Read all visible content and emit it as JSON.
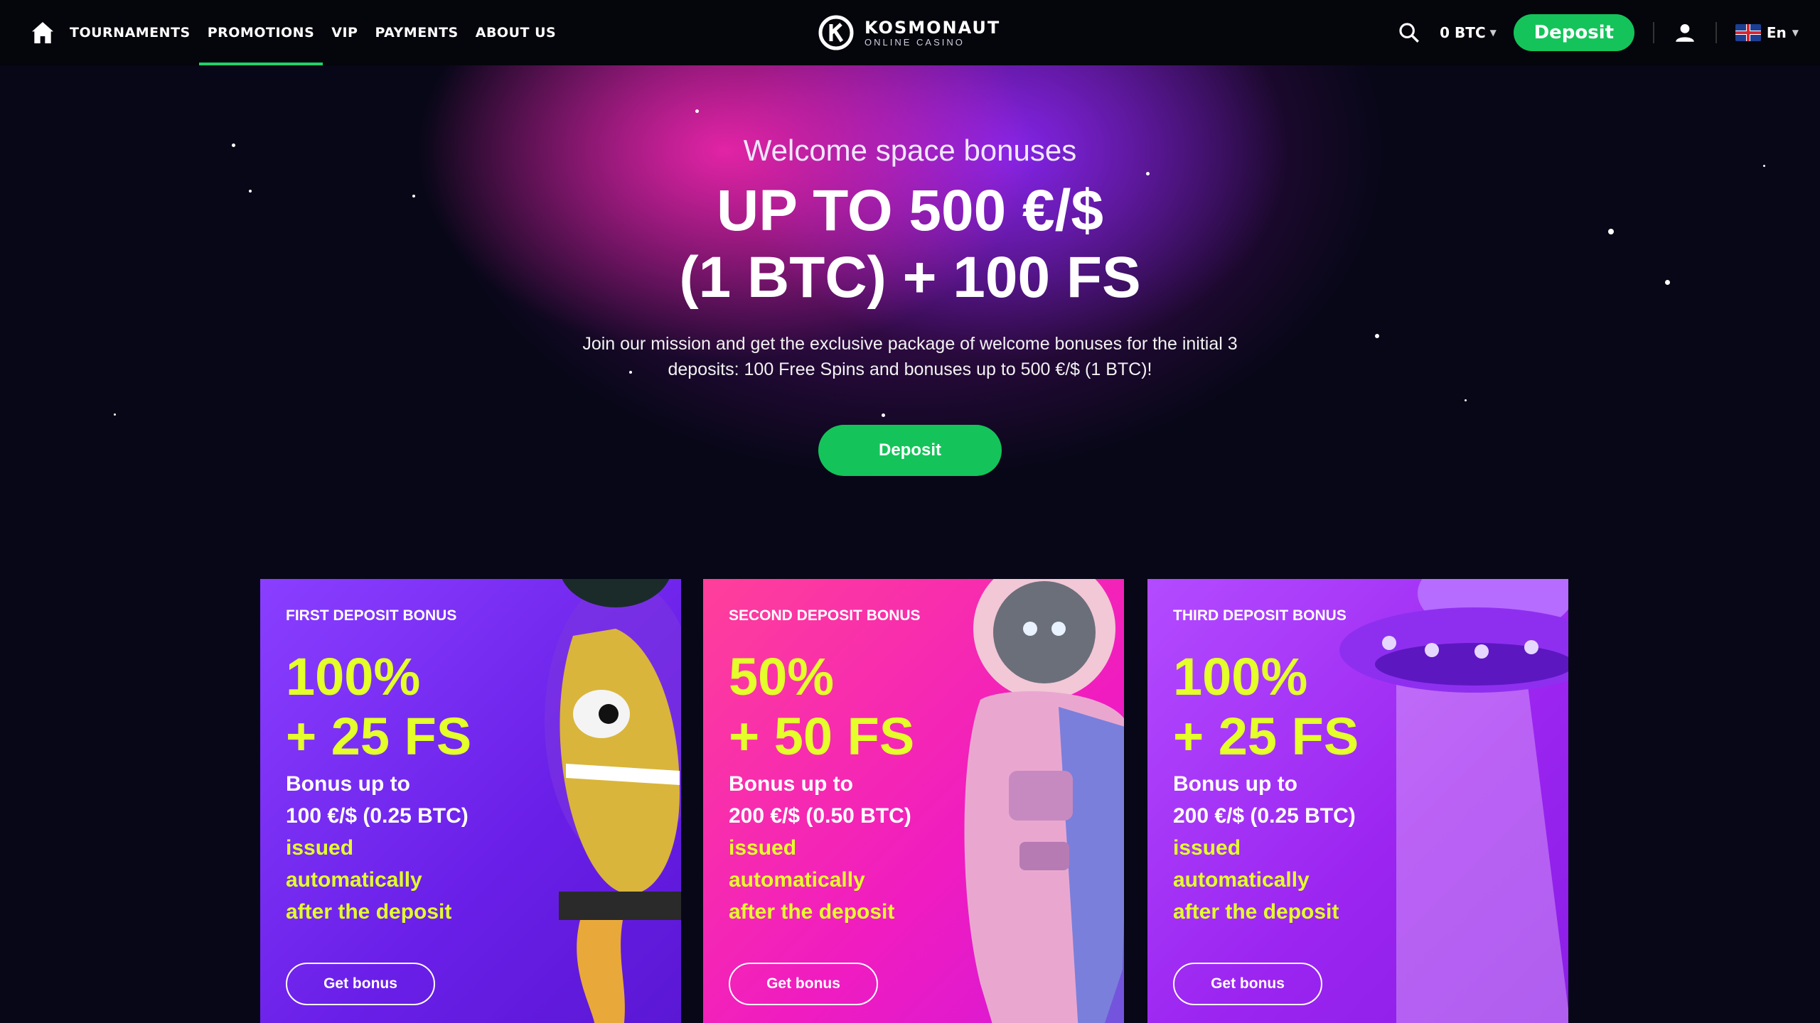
{
  "nav": {
    "home_icon": "home-icon",
    "items": [
      {
        "label": "TOURNAMENTS",
        "active": false
      },
      {
        "label": "PROMOTIONS",
        "active": true
      },
      {
        "label": "VIP",
        "active": false
      },
      {
        "label": "PAYMENTS",
        "active": false
      },
      {
        "label": "ABOUT US",
        "active": false
      }
    ]
  },
  "logo": {
    "name": "KOSMONAUT",
    "tagline": "ONLINE CASINO"
  },
  "header": {
    "balance": "0 BTC",
    "deposit_label": "Deposit",
    "language": "En",
    "accent_color": "#14c45a"
  },
  "hero": {
    "welcome": "Welcome space bonuses",
    "headline_line1": "UP TO 500 €/$",
    "headline_line2": "(1 BTC) + 100 FS",
    "description_line1": "Join our mission and get the exclusive package of welcome bonuses for the initial 3",
    "description_line2": "deposits: 100 Free Spins and bonuses up to 500 €/$ (1 BTC)!",
    "deposit_label": "Deposit"
  },
  "cards": [
    {
      "title": "FIRST DEPOSIT BONUS",
      "percent": "100%",
      "fs": "+ 25 FS",
      "bonus_label": "Bonus up to",
      "amount": "100 €/$ (0.25 BTC)",
      "note1": "issued",
      "note2": "automatically",
      "note3": "after the deposit",
      "button": "Get bonus"
    },
    {
      "title": "SECOND DEPOSIT BONUS",
      "percent": "50%",
      "fs": "+ 50 FS",
      "bonus_label": "Bonus up to",
      "amount": "200 €/$ (0.50 BTC)",
      "note1": "issued",
      "note2": "automatically",
      "note3": "after the deposit",
      "button": "Get bonus"
    },
    {
      "title": "THIRD DEPOSIT BONUS",
      "percent": "100%",
      "fs": "+ 25 FS",
      "bonus_label": "Bonus up to",
      "amount": "200 €/$ (0.25 BTC)",
      "note1": "issued",
      "note2": "automatically",
      "note3": "after the deposit",
      "button": "Get bonus"
    }
  ]
}
